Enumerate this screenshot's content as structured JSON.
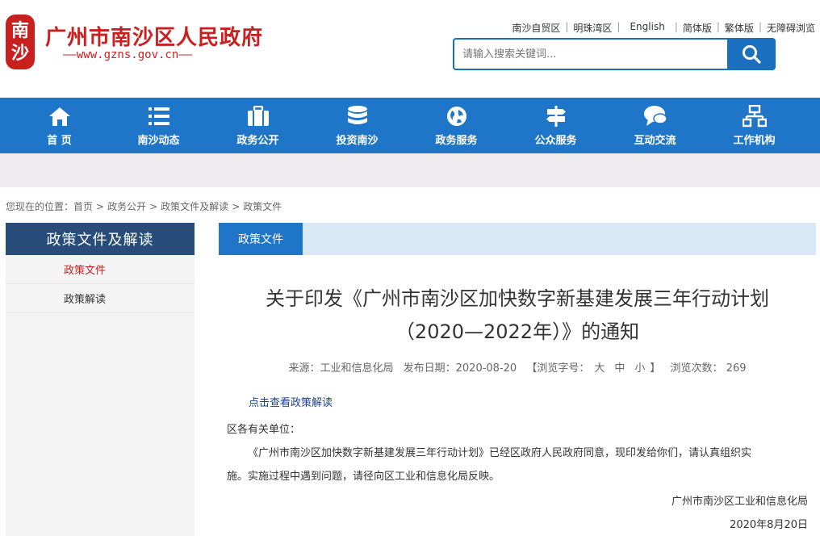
{
  "header": {
    "seal_chars": [
      "南",
      "沙"
    ],
    "site_title": "广州市南沙区人民政府",
    "site_url": "——www.gzns.gov.cn——",
    "top_links": [
      "南沙自贸区",
      "明珠湾区",
      "English",
      "简体版",
      "繁体版",
      "无障碍浏览"
    ],
    "search_placeholder": "请输入搜索关键词...",
    "brand_color": "#c8201f",
    "accent_color": "#1f76c9"
  },
  "nav": {
    "items": [
      {
        "label": "首 页",
        "icon": "home-icon"
      },
      {
        "label": "南沙动态",
        "icon": "list-icon"
      },
      {
        "label": "政务公开",
        "icon": "briefcase-icon"
      },
      {
        "label": "投资南沙",
        "icon": "coins-icon"
      },
      {
        "label": "政务服务",
        "icon": "globe-icon"
      },
      {
        "label": "公众服务",
        "icon": "signpost-icon"
      },
      {
        "label": "互动交流",
        "icon": "chat-icon"
      },
      {
        "label": "工作机构",
        "icon": "org-chart-icon"
      }
    ]
  },
  "breadcrumb": {
    "prefix": "您现在的位置：",
    "items": [
      "首页",
      "政务公开",
      "政策文件及解读",
      "政策文件"
    ]
  },
  "sidebar": {
    "title": "政策文件及解读",
    "items": [
      "政策文件",
      "政策解读"
    ]
  },
  "main": {
    "tab_label": "政策文件",
    "title_line1": "关于印发《广州市南沙区加快数字新基建发展三年行动计划",
    "title_line2": "（2020—2022年）》的通知",
    "meta": {
      "source": "来源：工业和信息化局",
      "date": "发布日期：2020-08-20",
      "font_open": "【浏览字号：",
      "font_large": "大",
      "font_medium": "中",
      "font_small": "小",
      "font_close": "】",
      "views_label": "浏览次数：",
      "views": "269"
    },
    "jiedu_link": "点击查看政策解读",
    "salutation": "区各有关单位：",
    "para1": "《广州市南沙区加快数字新基建发展三年行动计划》已经区政府人民政府同意，现印发给你们，请认真组织实",
    "para2": "施。实施过程中遇到问题，请径向区工业和信息化局反映。",
    "sign_org": "广州市南沙区工业和信息化局",
    "sign_date": "2020年8月20日"
  }
}
